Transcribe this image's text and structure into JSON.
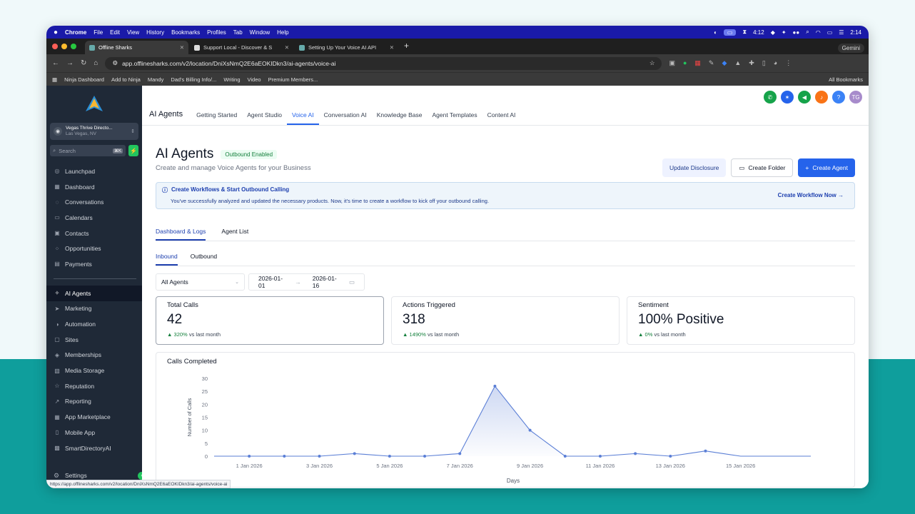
{
  "menubar": {
    "app": "Chrome",
    "items": [
      "File",
      "Edit",
      "View",
      "History",
      "Bookmarks",
      "Profiles",
      "Tab",
      "Window",
      "Help"
    ],
    "timer": "4:12",
    "clock": "2:14"
  },
  "browser": {
    "tabs": [
      {
        "label": "Offline Sharks"
      },
      {
        "label": "Support Local - Discover & S"
      },
      {
        "label": "Setting Up Your Voice AI API"
      }
    ],
    "gemini": "Gemini",
    "url": "app.offlinesharks.com/v2/location/DniXsNmQ2E6aEOKIDkn3/ai-agents/voice-ai",
    "bookmarks": [
      "Ninja Dashboard",
      "Add to Ninja",
      "Mandy",
      "Dad's Billing Info/...",
      "Writing",
      "Video",
      "Premium Members..."
    ],
    "all_bookmarks": "All Bookmarks",
    "status_url": "https://app.offlinesharks.com/v2/location/DniXsNmQ2E6aEOKIDkn3/ai-agents/voice-ai"
  },
  "sidebar": {
    "account_name": "Vegas Thrive Directo...",
    "account_location": "Las Vegas, NV",
    "search_placeholder": "Search",
    "search_kbd": "⌘K",
    "items_top": [
      {
        "label": "Launchpad",
        "icon": "◎"
      },
      {
        "label": "Dashboard",
        "icon": "▦"
      },
      {
        "label": "Conversations",
        "icon": "◌"
      },
      {
        "label": "Calendars",
        "icon": "▭"
      },
      {
        "label": "Contacts",
        "icon": "▣"
      },
      {
        "label": "Opportunities",
        "icon": "⁘"
      },
      {
        "label": "Payments",
        "icon": "▤"
      }
    ],
    "items_bottom": [
      {
        "label": "AI Agents",
        "icon": "✧"
      },
      {
        "label": "Marketing",
        "icon": "➤"
      },
      {
        "label": "Automation",
        "icon": "◑"
      },
      {
        "label": "Sites",
        "icon": "▢"
      },
      {
        "label": "Memberships",
        "icon": "◈"
      },
      {
        "label": "Media Storage",
        "icon": "▧"
      },
      {
        "label": "Reputation",
        "icon": "☆"
      },
      {
        "label": "Reporting",
        "icon": "↗"
      },
      {
        "label": "App Marketplace",
        "icon": "▦"
      },
      {
        "label": "Mobile App",
        "icon": "▯"
      },
      {
        "label": "SmartDirectoryAI",
        "icon": "▩"
      }
    ],
    "settings": "Settings"
  },
  "header": {
    "avatar_initials": "TG",
    "title": "AI Agents",
    "tabs": [
      "Getting Started",
      "Agent Studio",
      "Voice AI",
      "Conversation AI",
      "Knowledge Base",
      "Agent Templates",
      "Content AI"
    ]
  },
  "page": {
    "title": "AI Agents",
    "badge": "Outbound Enabled",
    "subtitle": "Create and manage Voice Agents for your Business",
    "btn_update": "Update Disclosure",
    "btn_folder": "Create Folder",
    "btn_create": "Create Agent",
    "banner_title": "Create Workflows & Start Outbound Calling",
    "banner_body": "You've successfully analyzed and updated the necessary products. Now, it's time to create a workflow to kick off your outbound calling.",
    "banner_link": "Create Workflow Now",
    "tabs": [
      "Dashboard & Logs",
      "Agent List"
    ],
    "subtabs": [
      "Inbound",
      "Outbound"
    ],
    "agent_filter": "All Agents",
    "date_from": "2026-01-01",
    "date_to": "2026-01-16"
  },
  "cards": [
    {
      "title": "Total Calls",
      "value": "42",
      "delta": "320%",
      "suffix": "vs last month"
    },
    {
      "title": "Actions Triggered",
      "value": "318",
      "delta": "1490%",
      "suffix": "vs last month"
    },
    {
      "title": "Sentiment",
      "value": "100% Positive",
      "delta": "0%",
      "suffix": "vs last month"
    }
  ],
  "chart_title": "Calls Completed",
  "chart_data": {
    "type": "area",
    "title": "Calls Completed",
    "xlabel": "Days",
    "ylabel": "Number of Calls",
    "ylim": [
      0,
      30
    ],
    "yticks": [
      0,
      5,
      10,
      15,
      20,
      25,
      30
    ],
    "xtick_labels": [
      "1 Jan 2026",
      "3 Jan 2026",
      "5 Jan 2026",
      "7 Jan 2026",
      "9 Jan 2026",
      "11 Jan 2026",
      "13 Jan 2026",
      "15 Jan 2026"
    ],
    "x": [
      "31 Dec 2025",
      "1 Jan 2026",
      "2 Jan 2026",
      "3 Jan 2026",
      "4 Jan 2026",
      "5 Jan 2026",
      "6 Jan 2026",
      "7 Jan 2026",
      "8 Jan 2026",
      "9 Jan 2026",
      "10 Jan 2026",
      "11 Jan 2026",
      "12 Jan 2026",
      "13 Jan 2026",
      "14 Jan 2026",
      "15 Jan 2026",
      "16 Jan 2026",
      "17 Jan 2026"
    ],
    "series": [
      {
        "values": [
          0,
          0,
          0,
          0,
          1,
          0,
          0,
          1,
          27,
          10,
          0,
          0,
          1,
          0,
          2,
          0,
          0,
          0
        ]
      }
    ],
    "marker_index_start": 1,
    "marker_index_end": 14,
    "color": "#5b7fd6",
    "grid": false
  }
}
